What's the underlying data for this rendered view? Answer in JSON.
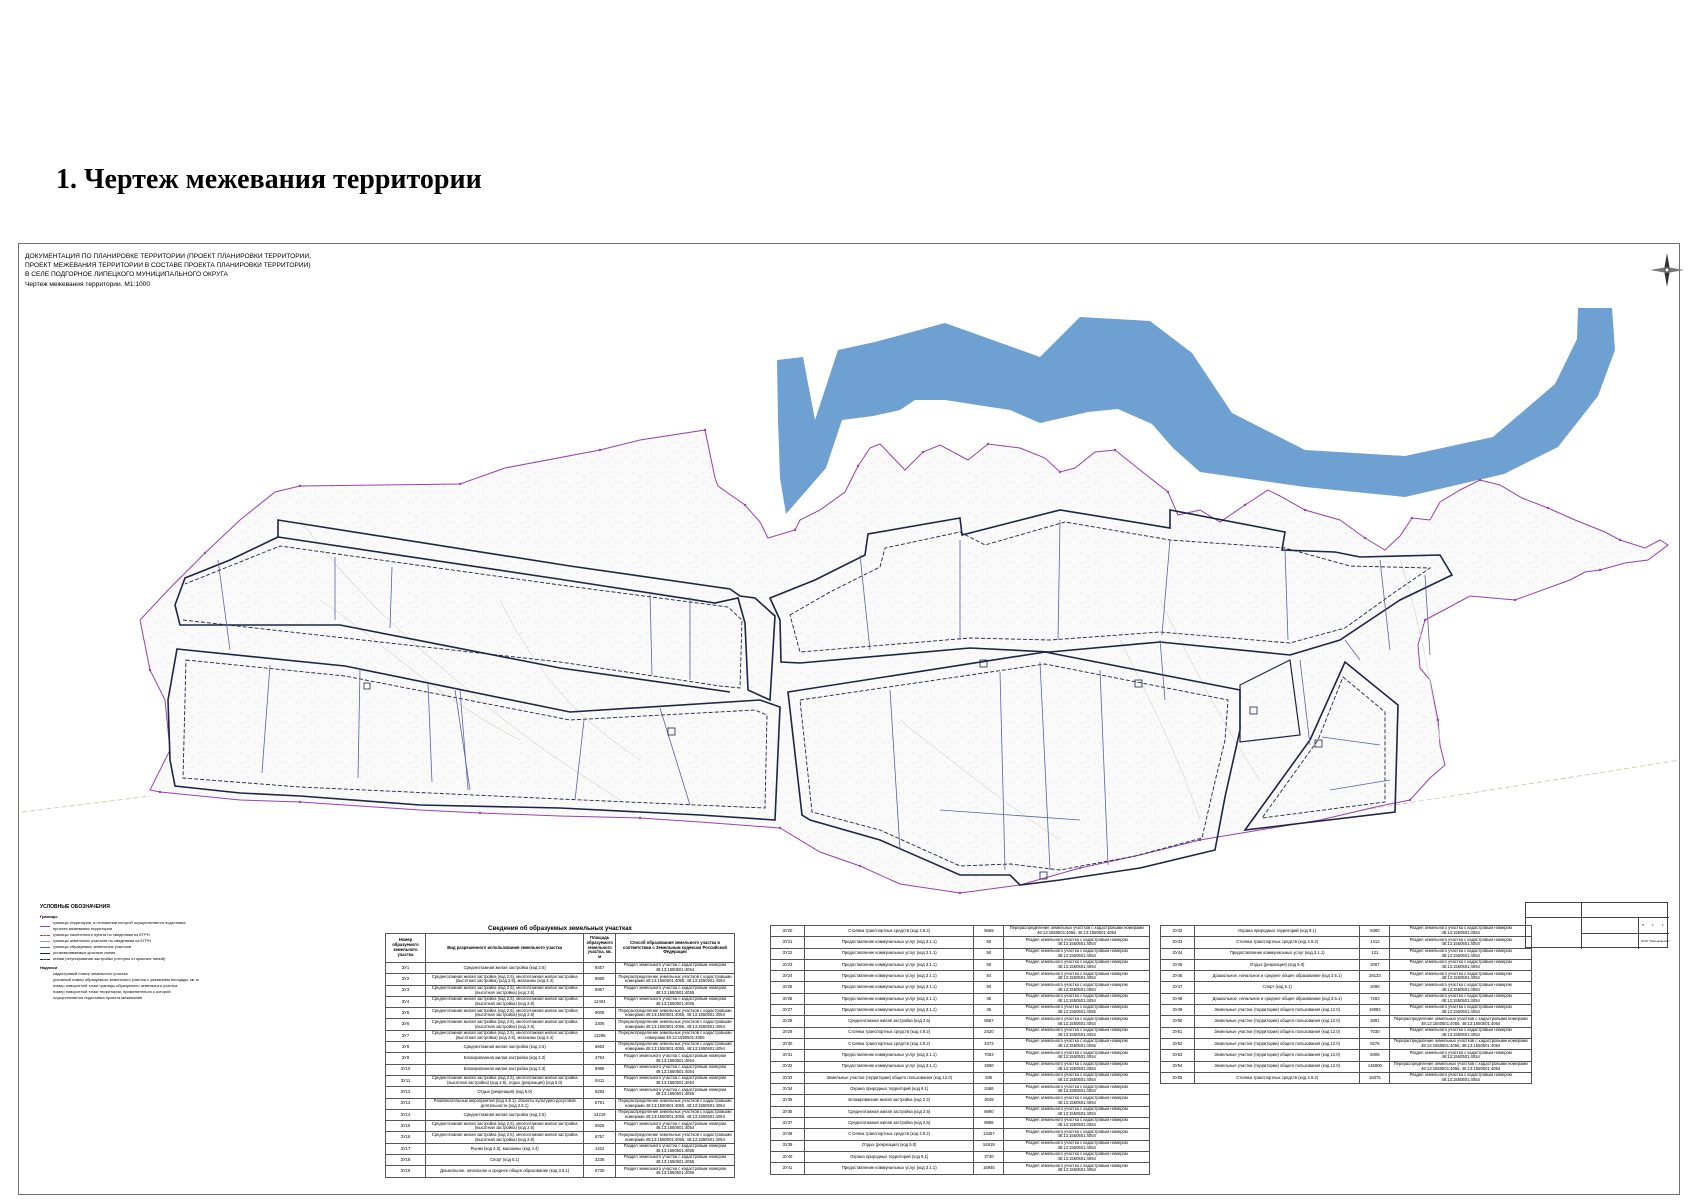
{
  "page_heading": "1. Чертеж межевания территории",
  "sheet": {
    "title_lines": [
      "ДОКУМЕНТАЦИЯ ПО ПЛАНИРОВКЕ ТЕРРИТОРИИ (ПРОЕКТ ПЛАНИРОВКИ ТЕРРИТОРИИ,",
      "ПРОЕКТ МЕЖЕВАНИЯ ТЕРРИТОРИИ В СОСТАВЕ ПРОЕКТА ПЛАНИРОВКИ ТЕРРИТОРИИ)",
      "В СЕЛЕ ПОДГОРНОЕ ЛИПЕЦКОГО МУНИЦИПАЛЬНОГО ОКРУГА"
    ],
    "scale_title": "Чертеж межевания территории. М1:1000"
  },
  "colors": {
    "water": "#6fa0d2",
    "block_boundary": "#1e2446",
    "parcel_line": "#5a5fb2",
    "territory_boundary": "#9b3fb0",
    "terrain": "#c6c6c6"
  },
  "legend": {
    "title": "УСЛОВНЫЕ ОБОЗНАЧЕНИЯ",
    "group1_title": "Границы",
    "group1": [
      "границы территории, в отношении которой осуществляется подготовка проекта межевания территории",
      "границы населенного пункта по сведениям из ЕГРН",
      "границы земельных участков по сведениям из ЕГРН",
      "границы образуемых земельных участков",
      "устанавливаемые красные линии",
      "линии регулирования застройки (отступы от красных линий)"
    ],
    "group2_title": "Надписи",
    "group2": [
      "кадастровый номер земельного участка",
      "условный номер образуемого земельного участка с указанием площади, кв. м",
      "номер поворотной точки границы образуемого земельного участка",
      "номер поворотной точки территории, применительно к которой осуществляется подготовка проекта межевания"
    ]
  },
  "parcel_table": {
    "caption": "Сведения об образуемых земельных участках",
    "headers": [
      "Номер образуемого земельного участка",
      "Вид разрешенного использования земельного участка",
      "Площадь образуемого земельного участка, кв. м",
      "Способ образования земельного участка в соответствии с Земельным кодексом Российской Федерации"
    ],
    "rows": [
      [
        "ЗУ1",
        "Среднеэтажная жилая застройка (код 2.5)",
        "8457",
        "Раздел земельного участка с кадастровым номером 48:13:1550501:4054"
      ],
      [
        "ЗУ2",
        "Среднеэтажная жилая застройка (код 2.5), многоэтажная жилая застройка (высотная застройка) (код 2.6), магазины (код 4.4)",
        "8880",
        "Перераспределение земельных участков с кадастровыми номерами 48:13:1550501:4055, 48:13:1550501:4054"
      ],
      [
        "ЗУ3",
        "Среднеэтажная жилая застройка (код 2.5), многоэтажная жилая застройка (высотная застройка) (код 2.6)",
        "5867",
        "Раздел земельного участка с кадастровым номером 48:13:1550501:4055"
      ],
      [
        "ЗУ4",
        "Среднеэтажная жилая застройка (код 2.5), многоэтажная жилая застройка (высотная застройка) (код 2.6)",
        "12404",
        "Раздел земельного участка с кадастровым номером 48:13:1550501:4055"
      ],
      [
        "ЗУ5",
        "Среднеэтажная жилая застройка (код 2.5), многоэтажная жилая застройка (высотная застройка) (код 2.6)",
        "9009",
        "Перераспределение земельных участков с кадастровыми номерами 48:13:1550501:4055, 48:13:1550501:4054"
      ],
      [
        "ЗУ6",
        "Среднеэтажная жилая застройка (код 2.5), многоэтажная жилая застройка (высотная застройка) (код 2.6)",
        "3306",
        "Перераспределение земельных участков с кадастровыми номерами 48:13:1550501:4055, 48:13:1550501:4054"
      ],
      [
        "ЗУ7",
        "Среднеэтажная жилая застройка (код 2.5), многоэтажная жилая застройка (высотная застройка) (код 2.6), магазины (код 4.4)",
        "13285",
        "Перераспределение земельных участков с кадастровыми номерами 48:13:1550501:4055"
      ],
      [
        "ЗУ8",
        "Среднеэтажная жилая застройка (код 2.5)",
        "5663",
        "Перераспределение земельных участков с кадастровыми номерами 48:13:1550501:4055, 48:13:1550501:4054"
      ],
      [
        "ЗУ9",
        "Блокированная жилая застройка (код 2.3)",
        "4784",
        "Раздел земельного участка с кадастровым номером 48:13:1550501:4054"
      ],
      [
        "ЗУ10",
        "Блокированная жилая застройка (код 2.3)",
        "6986",
        "Раздел земельного участка с кадастровым номером 48:13:1550501:4054"
      ],
      [
        "ЗУ11",
        "Среднеэтажная жилая застройка (код 2.5), многоэтажная жилая застройка (высотная застройка) (код 2.6), отдых (рекреация) (код 5.0)",
        "9411",
        "Раздел земельного участка с кадастровым номером 48:13:1550501:4054"
      ],
      [
        "ЗУ12",
        "Отдых (рекреация) (код 5.0)",
        "6293",
        "Раздел земельного участка с кадастровым номером 48:13:1550501:4055"
      ],
      [
        "ЗУ13",
        "Развлекательные мероприятия (код 4.8.1), объекты культурно-досуговой деятельности (код 3.6.1)",
        "6791",
        "Перераспределение земельных участков с кадастровыми номерами 48:13:1550501:4055, 48:13:1550501:4054"
      ],
      [
        "ЗУ14",
        "Среднеэтажная жилая застройка (код 2.5)",
        "14219",
        "Перераспределение земельных участков с кадастровыми номерами 48:13:1550501:4055, 48:13:1550501:4054"
      ],
      [
        "ЗУ15",
        "Среднеэтажная жилая застройка (код 2.5), многоэтажная жилая застройка (высотная застройка) (код 2.6)",
        "5825",
        "Раздел земельного участка с кадастровым номером 48:13:1550501:4054"
      ],
      [
        "ЗУ16",
        "Среднеэтажная жилая застройка (код 2.5), многоэтажная жилая застройка (высотная застройка) (код 2.6)",
        "6757",
        "Перераспределение земельных участков с кадастровыми номерами 48:13:1550501:4055, 48:13:1550501:4054"
      ],
      [
        "ЗУ17",
        "Рынки (код 4.3), магазины (код 4.4)",
        "1424",
        "Раздел земельного участка с кадастровым номером 48:13:1550501:4055"
      ],
      [
        "ЗУ18",
        "Спорт (код 5.1)",
        "3236",
        "Раздел земельного участка с кадастровым номером 48:13:1550501:4055"
      ],
      [
        "ЗУ19",
        "Дошкольное, начальное и среднее общее образование (код 3.5.1)",
        "8730",
        "Раздел земельного участка с кадастровым номером 48:13:1550501:4055"
      ],
      [
        "ЗУ20",
        "Стоянка транспортных средств (код 4.9.2)",
        "5669",
        "Перераспределение земельных участков с кадастровыми номерами 48:13:1550501:4055, 48:13:1550501:4054"
      ],
      [
        "ЗУ21",
        "Предоставление коммунальных услуг (код 3.1.1)",
        "50",
        "Раздел земельного участка с кадастровым номером 48:13:1550501:4054"
      ],
      [
        "ЗУ22",
        "Предоставление коммунальных услуг (код 3.1.1)",
        "50",
        "Раздел земельного участка с кадастровым номером 48:13:1550501:4054"
      ],
      [
        "ЗУ23",
        "Предоставление коммунальных услуг (код 3.1.1)",
        "50",
        "Раздел земельного участка с кадастровым номером 48:13:1550501:4054"
      ],
      [
        "ЗУ24",
        "Предоставление коммунальных услуг (код 3.1.1)",
        "84",
        "Раздел земельного участка с кадастровым номером 48:13:1550501:4054"
      ],
      [
        "ЗУ25",
        "Предоставление коммунальных услуг (код 3.1.1)",
        "50",
        "Раздел земельного участка с кадастровым номером 48:13:1550501:4054"
      ],
      [
        "ЗУ26",
        "Предоставление коммунальных услуг (код 3.1.1)",
        "35",
        "Раздел земельного участка с кадастровым номером 48:13:1550501:4054"
      ],
      [
        "ЗУ27",
        "Предоставление коммунальных услуг (код 3.1.1)",
        "35",
        "Раздел земельного участка с кадастровым номером 48:13:1550501:4055"
      ],
      [
        "ЗУ28",
        "Среднеэтажная жилая застройка (код 2.5)",
        "6667",
        "Раздел земельного участка с кадастровым номером 48:13:1550501:4054"
      ],
      [
        "ЗУ29",
        "Стоянка транспортных средств (код 4.9.2)",
        "2420",
        "Раздел земельного участка с кадастровым номером 48:13:1550501:4054"
      ],
      [
        "ЗУ30",
        "Стоянка транспортных средств (код 4.9.2)",
        "4373",
        "Раздел земельного участка с кадастровым номером 48:13:1550501:4055"
      ],
      [
        "ЗУ31",
        "Предоставление коммунальных услуг (код 3.1.1)",
        "7083",
        "Раздел земельного участка с кадастровым номером 48:13:1550501:4054"
      ],
      [
        "ЗУ32",
        "Предоставление коммунальных услуг (код 3.1.1)",
        "2980",
        "Раздел земельного участка с кадастровым номером 48:13:1550501:4054"
      ],
      [
        "ЗУ33",
        "Земельные участки (территории) общего пользования (код 12.0)",
        "835",
        "Раздел земельного участка с кадастровым номером 48:13:1550501:4054"
      ],
      [
        "ЗУ34",
        "Охрана природных территорий (код 9.1)",
        "2486",
        "Раздел земельного участка с кадастровым номером 48:13:1550501:4054"
      ],
      [
        "ЗУ35",
        "Блокированная жилая застройка (код 2.3)",
        "3049",
        "Раздел земельного участка с кадастровым номером 48:13:1550501:4054"
      ],
      [
        "ЗУ36",
        "Среднеэтажная жилая застройка (код 2.5)",
        "6990",
        "Раздел земельного участка с кадастровым номером 48:13:1550501:4054"
      ],
      [
        "ЗУ37",
        "Среднеэтажная жилая застройка (код 2.5)",
        "8986",
        "Раздел земельного участка с кадастровым номером 48:13:1550501:4054"
      ],
      [
        "ЗУ38",
        "Стоянка транспортных средств (код 4.9.2)",
        "13257",
        "Раздел земельного участка с кадастровым номером 48:13:1550501:4054"
      ],
      [
        "ЗУ39",
        "Отдых (рекреация) (код 5.0)",
        "54918",
        "Раздел земельного участка с кадастровым номером 48:13:1550501:4054"
      ],
      [
        "ЗУ40",
        "Охрана природных территорий (код 9.1)",
        "3740",
        "Раздел земельного участка с кадастровым номером 48:13:1550501:4054"
      ],
      [
        "ЗУ41",
        "Предоставление коммунальных услуг (код 3.1.1)",
        "15945",
        "Раздел земельного участка с кадастровым номером 48:13:1550501:4054"
      ],
      [
        "ЗУ42",
        "Охрана природных территорий (код 9.1)",
        "5380",
        "Раздел земельного участка с кадастровым номером 48:13:1550501:4054"
      ],
      [
        "ЗУ43",
        "Стоянка транспортных средств (код 4.9.2)",
        "1412",
        "Раздел земельного участка с кадастровым номером 48:13:1550501:4054"
      ],
      [
        "ЗУ44",
        "Предоставление коммунальных услуг (код 3.1.1)",
        "121",
        "Раздел земельного участка с кадастровым номером 48:13:1550501:4054"
      ],
      [
        "ЗУ45",
        "Отдых (рекреация) (код 5.0)",
        "2067",
        "Раздел земельного участка с кадастровым номером 48:13:1550501:4054"
      ],
      [
        "ЗУ46",
        "Дошкольное, начальное и среднее общее образование (код 3.5.1)",
        "28133",
        "Раздел земельного участка с кадастровым номером 48:13:1550501:4054"
      ],
      [
        "ЗУ47",
        "Спорт (код 5.1)",
        "2090",
        "Раздел земельного участка с кадастровым номером 48:13:1550501:4054"
      ],
      [
        "ЗУ48",
        "Дошкольное, начальное и среднее общее образование (код 3.5.1)",
        "7283",
        "Раздел земельного участка с кадастровым номером 48:13:1550501:4054"
      ],
      [
        "ЗУ49",
        "Земельные участки (территории) общего пользования (код 12.0)",
        "19082",
        "Раздел земельного участка с кадастровым номером 48:13:1550501:4054"
      ],
      [
        "ЗУ50",
        "Земельные участки (территории) общего пользования (код 12.0)",
        "2891",
        "Перераспределение земельных участков с кадастровыми номерами 48:13:1550501:4055, 48:13:1550501:4054"
      ],
      [
        "ЗУ51",
        "Земельные участки (территории) общего пользования (код 12.0)",
        "7030",
        "Раздел земельного участка с кадастровым номером 48:13:1550501:4054"
      ],
      [
        "ЗУ52",
        "Земельные участки (территории) общего пользования (код 12.0)",
        "9276",
        "Перераспределение земельных участков с кадастровыми номерами 48:13:1550501:4055, 48:13:1550501:4054"
      ],
      [
        "ЗУ53",
        "Земельные участки (территории) общего пользования (код 12.0)",
        "8406",
        "Раздел земельного участка с кадастровым номером 48:13:1550501:4054"
      ],
      [
        "ЗУ54",
        "Земельные участки (территории) общего пользования (код 12.0)",
        "145800",
        "Перераспределение земельных участков с кадастровыми номерами 48:13:1550501:4055, 48:13:1550501:4054"
      ],
      [
        "ЗУ55",
        "Стоянка транспортных средств (код 4.9.2)",
        "18375",
        "Раздел земельного участка с кадастровым номером 48:13:1550501:4054"
      ]
    ]
  },
  "stamp": {
    "org": "ООО \"Липецкпроект\"",
    "stage": "П",
    "sheet": "1",
    "sheets": "1"
  }
}
